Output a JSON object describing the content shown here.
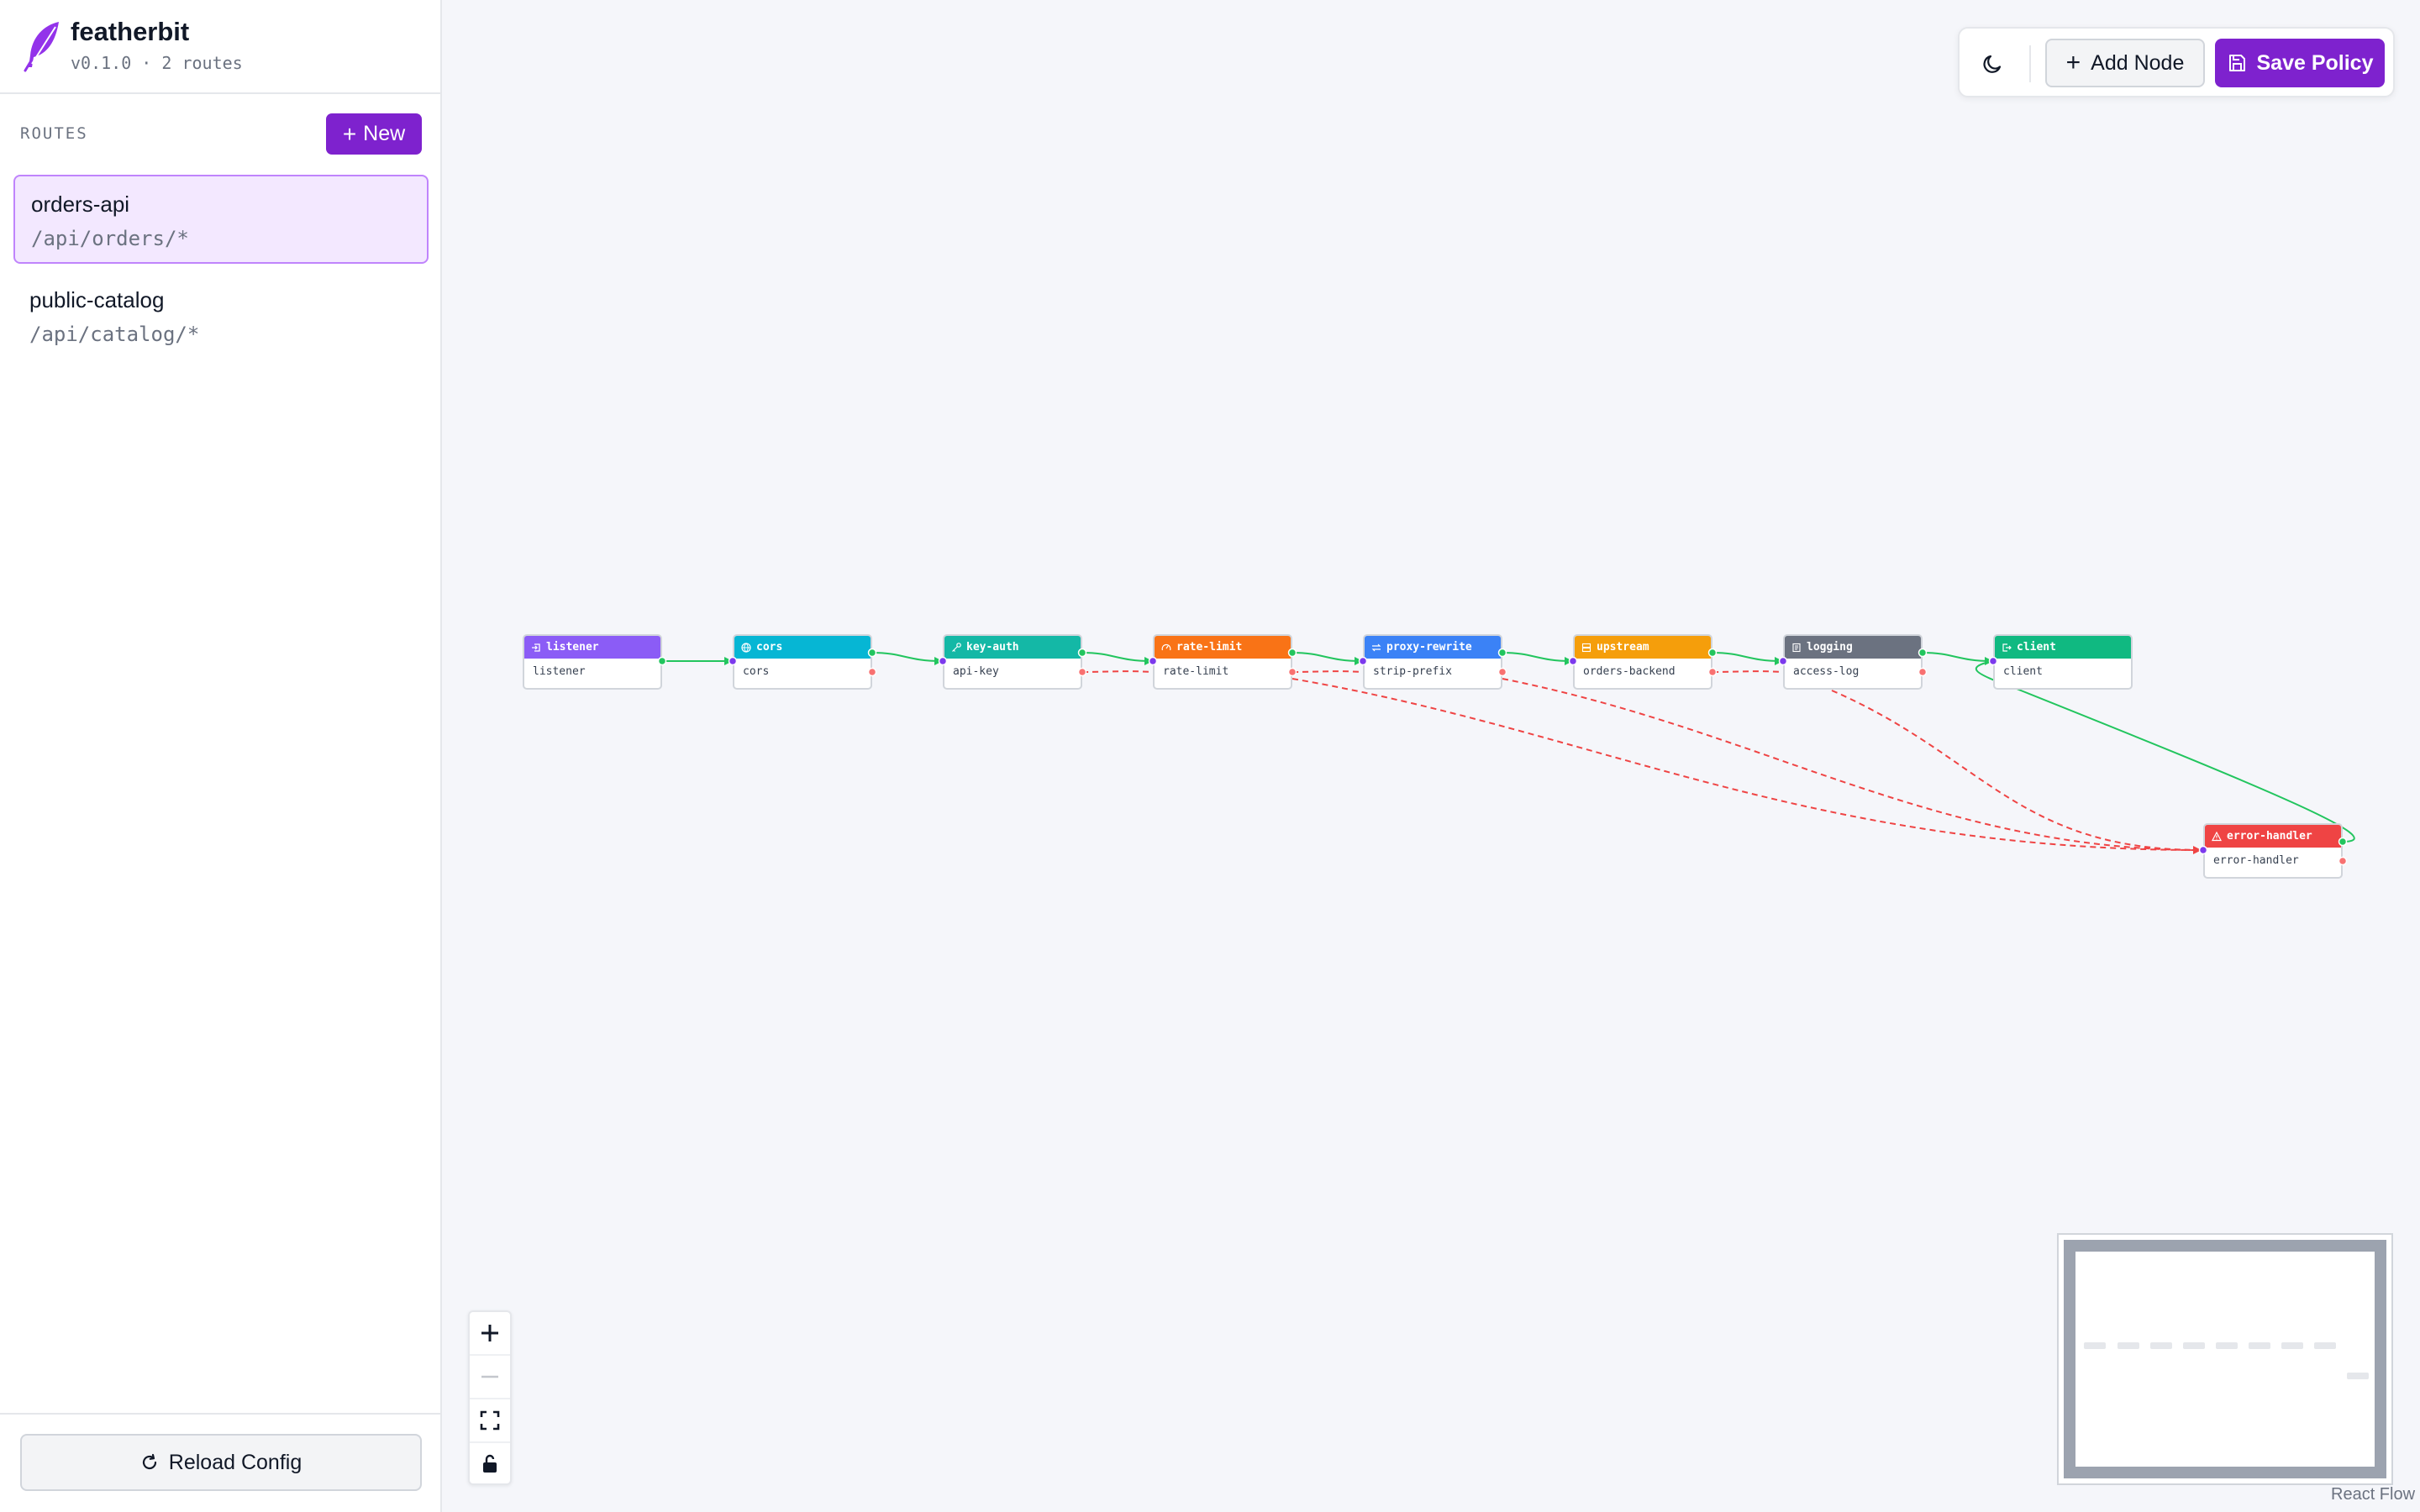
{
  "app": {
    "name": "featherbit",
    "meta": "v0.1.0 · 2 routes"
  },
  "sidebar": {
    "routes_heading": "ROUTES",
    "new_label": "New",
    "routes": [
      {
        "name": "orders-api",
        "path": "/api/orders/*",
        "active": true
      },
      {
        "name": "public-catalog",
        "path": "/api/catalog/*",
        "active": false
      }
    ],
    "reload_label": "Reload Config"
  },
  "toolbar": {
    "add_node_label": "Add Node",
    "save_label": "Save Policy"
  },
  "nodes": [
    {
      "id": "listener",
      "type": "listener",
      "label": "listener",
      "color": "#8b5cf6",
      "icon": "login-icon"
    },
    {
      "id": "cors",
      "type": "cors",
      "label": "cors",
      "color": "#06b6d4",
      "icon": "globe-icon"
    },
    {
      "id": "key-auth",
      "type": "key-auth",
      "label": "api-key",
      "color": "#14b8a6",
      "icon": "key-icon"
    },
    {
      "id": "rate-limit",
      "type": "rate-limit",
      "label": "rate-limit",
      "color": "#f97316",
      "icon": "gauge-icon"
    },
    {
      "id": "proxy-rewrite",
      "type": "proxy-rewrite",
      "label": "strip-prefix",
      "color": "#3b82f6",
      "icon": "swap-icon"
    },
    {
      "id": "upstream",
      "type": "upstream",
      "label": "orders-backend",
      "color": "#f59e0b",
      "icon": "server-icon"
    },
    {
      "id": "logging",
      "type": "logging",
      "label": "access-log",
      "color": "#6b7280",
      "icon": "scroll-icon"
    },
    {
      "id": "client",
      "type": "client",
      "label": "client",
      "color": "#10b981",
      "icon": "logout-icon"
    },
    {
      "id": "error-handler",
      "type": "error-handler",
      "label": "error-handler",
      "color": "#ef4444",
      "icon": "warning-icon"
    }
  ],
  "footer": {
    "attribution": "React Flow"
  },
  "colors": {
    "accent": "#7e22ce",
    "success_edge": "#22c55e",
    "error_edge": "#ef4444"
  }
}
